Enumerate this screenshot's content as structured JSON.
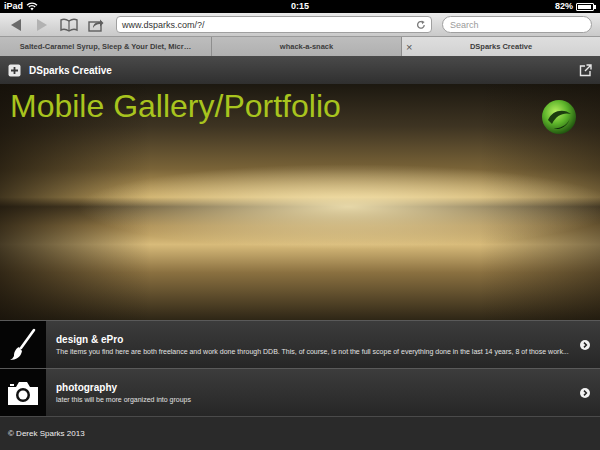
{
  "status_bar": {
    "device": "iPad",
    "time": "0:15",
    "battery": "82%",
    "battery_level": 0.82
  },
  "browser": {
    "url": "www.dsparks.com/?/",
    "search_placeholder": "Search",
    "back_enabled": true,
    "forward_enabled": false,
    "tab_close": "×"
  },
  "tabs": [
    {
      "label": "Salted-Caramel Syrup, Sleep & Your Diet, Micr…",
      "selected": false
    },
    {
      "label": "whack-a-snack",
      "selected": false
    },
    {
      "label": "DSparks Creative",
      "selected": true
    }
  ],
  "site_header": {
    "title": "DSparks Creative"
  },
  "hero": {
    "title": "Mobile Gallery/Portfolio"
  },
  "list": [
    {
      "kind": "brush",
      "title": "design & ePro",
      "subtitle": "The items you find here are both freelance and work done through DDB. This, of course, is not the full scope of everything done in the last 14 years, 8 of those work..."
    },
    {
      "kind": "camera",
      "title": "photography",
      "subtitle": "later this will be more organized into groups"
    }
  ],
  "footer": {
    "text": "© Derek Sparks 2013"
  }
}
